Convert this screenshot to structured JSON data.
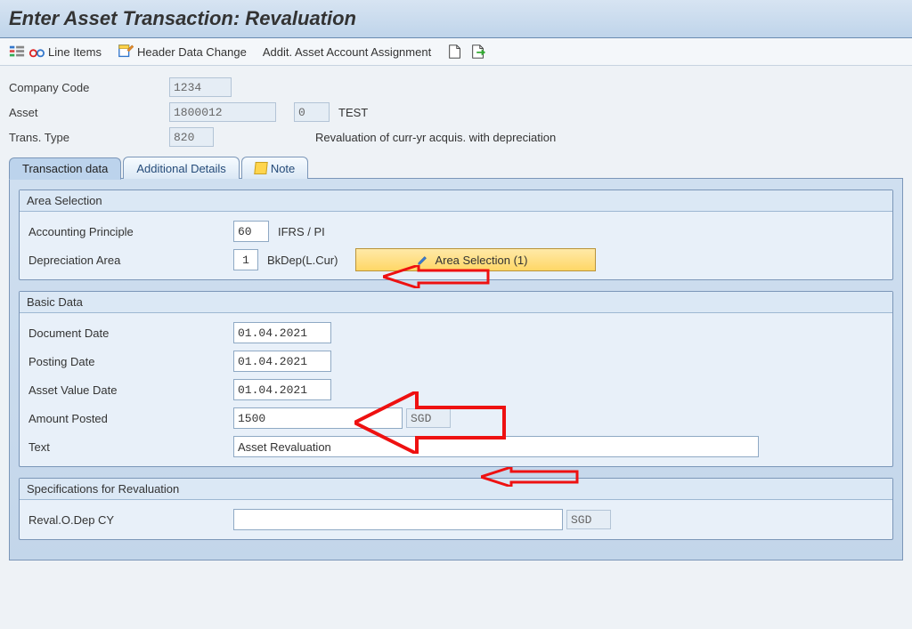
{
  "title": "Enter Asset Transaction: Revaluation",
  "toolbar": {
    "lineItems": "Line Items",
    "headerDataChange": "Header Data Change",
    "additAssign": "Addit. Asset Account Assignment"
  },
  "header": {
    "companyCode_label": "Company Code",
    "companyCode": "1234",
    "asset_label": "Asset",
    "asset": "1800012",
    "assetSub": "0",
    "assetDesc": "TEST",
    "transType_label": "Trans. Type",
    "transType": "820",
    "transTypeDesc": "Revaluation of curr-yr acquis. with depreciation"
  },
  "tabs": {
    "t1": "Transaction data",
    "t2": "Additional Details",
    "t3": "Note"
  },
  "areaSelection": {
    "title": "Area Selection",
    "accPrinc_label": "Accounting Principle",
    "accPrinc": "60",
    "accPrincDesc": "IFRS / PI",
    "depArea_label": "Depreciation Area",
    "depArea": "1",
    "depAreaDesc": "BkDep(L.Cur)",
    "areaBtn": "Area Selection (1)"
  },
  "basicData": {
    "title": "Basic Data",
    "docDate_label": "Document Date",
    "docDate": "01.04.2021",
    "postDate_label": "Posting Date",
    "postDate": "01.04.2021",
    "avDate_label": "Asset Value Date",
    "avDate": "01.04.2021",
    "amountPosted_label": "Amount Posted",
    "amountPosted": "1500",
    "currency": "SGD",
    "text_label": "Text",
    "text": "Asset Revaluation"
  },
  "specs": {
    "title": "Specifications for Revaluation",
    "revalODepCY_label": "Reval.O.Dep CY",
    "revalODepCY": "",
    "currency": "SGD"
  }
}
